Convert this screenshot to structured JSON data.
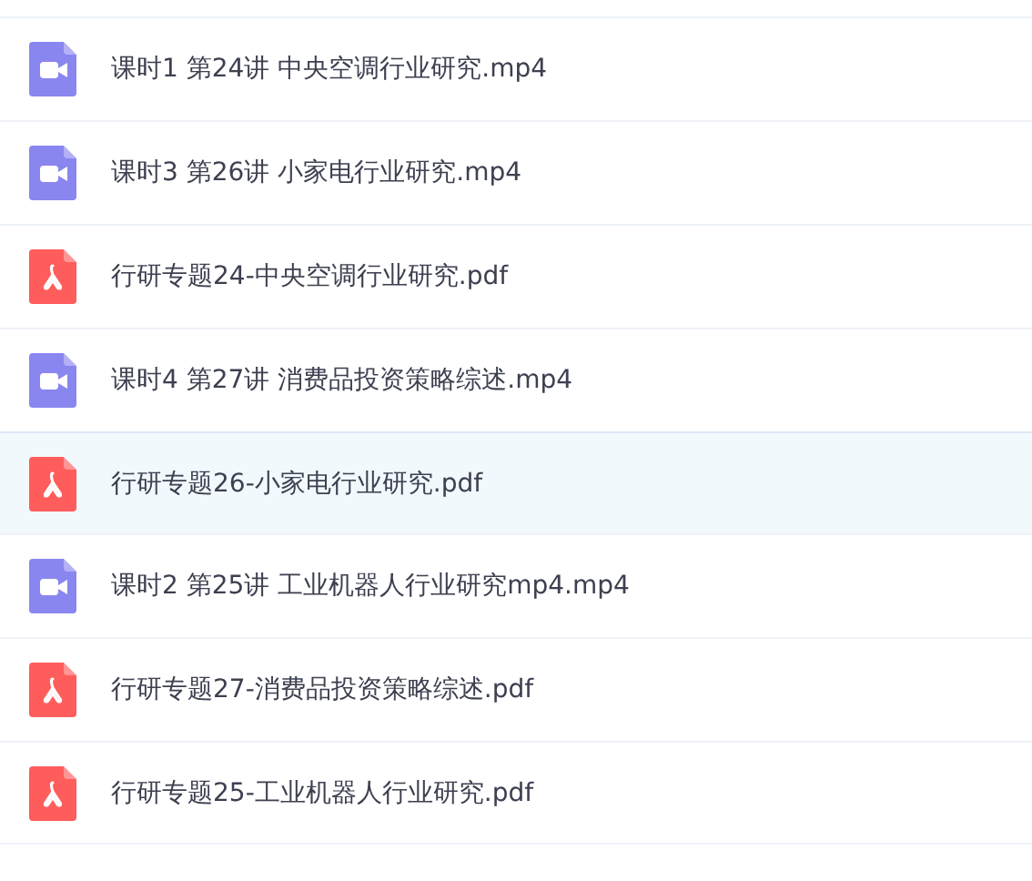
{
  "files": [
    {
      "kind": "video",
      "name": "课时1 第24讲 中央空调行业研究.mp4",
      "selected": false
    },
    {
      "kind": "video",
      "name": "课时3 第26讲 小家电行业研究.mp4",
      "selected": false
    },
    {
      "kind": "pdf",
      "name": "行研专题24-中央空调行业研究.pdf",
      "selected": false
    },
    {
      "kind": "video",
      "name": "课时4 第27讲 消费品投资策略综述.mp4",
      "selected": false
    },
    {
      "kind": "pdf",
      "name": "行研专题26-小家电行业研究.pdf",
      "selected": true
    },
    {
      "kind": "video",
      "name": "课时2 第25讲 工业机器人行业研究mp4.mp4",
      "selected": false
    },
    {
      "kind": "pdf",
      "name": "行研专题27-消费品投资策略综述.pdf",
      "selected": false
    },
    {
      "kind": "pdf",
      "name": "行研专题25-工业机器人行业研究.pdf",
      "selected": false
    }
  ]
}
